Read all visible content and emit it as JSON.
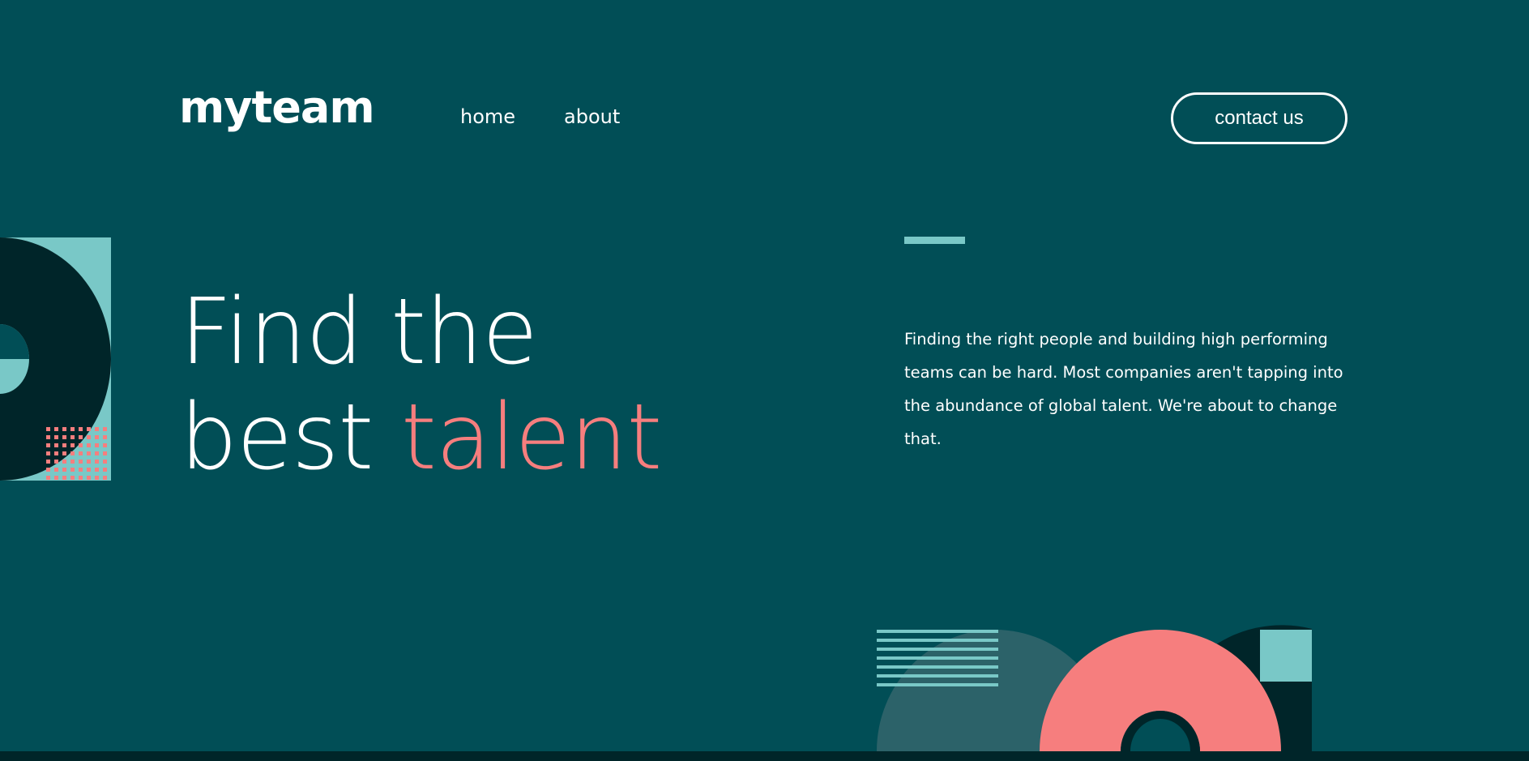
{
  "brand": {
    "logo_text": "myteam"
  },
  "nav": {
    "items": [
      {
        "label": "home"
      },
      {
        "label": "about"
      }
    ]
  },
  "header": {
    "contact_label": "contact us"
  },
  "hero": {
    "headline_line1": "Find the",
    "headline_line2_plain": "best",
    "headline_line2_accent": "talent",
    "intro": "Finding the right people and building high performing teams can be hard. Most companies aren't tapping into the abundance of global talent. We're about to change that."
  },
  "colors": {
    "background": "#014e56",
    "dark": "#002529",
    "coral": "#f67e7e",
    "teal_light": "#79c8c7",
    "teal_mid": "#2c6269",
    "white": "#ffffff"
  }
}
